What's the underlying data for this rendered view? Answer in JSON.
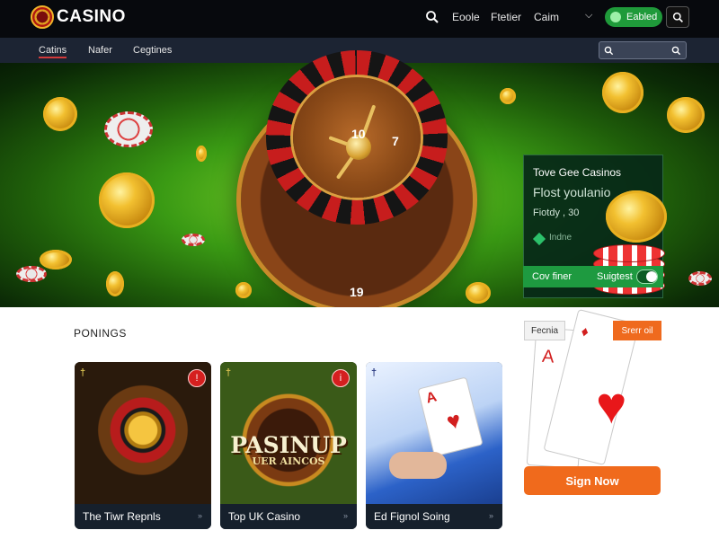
{
  "brand": {
    "name": "CASINO"
  },
  "topbar": {
    "links": [
      "Eoole",
      "Ftetier",
      "Caim"
    ],
    "enabled_label": "Eabled"
  },
  "nav": {
    "tabs": [
      "Catins",
      "Nafer",
      "Cegtines"
    ],
    "active_tab": "Catins",
    "search_placeholder": ""
  },
  "hero": {
    "wheel_numbers": [
      "10",
      "7",
      "19"
    ],
    "promo": {
      "title": "Tove Gee Casinos",
      "subtitle": "Flost youlanio",
      "price": "Fiotdy , 30",
      "flag_label": "Indne",
      "bar_left": "Cov finer",
      "bar_right": "Suigtest"
    }
  },
  "section": {
    "label": "PONINGS"
  },
  "cards": [
    {
      "title": "The Tiwr Repnls",
      "badge": "!"
    },
    {
      "title": "Top UK Casino",
      "badge": "i",
      "logo_text": "PASINUP",
      "logo_sub": "UER AINCOS"
    },
    {
      "title": "Ed Fignol Soing"
    }
  ],
  "side": {
    "tag_left": "Fecnia",
    "tag_right": "Srerr oil",
    "signup_label": "Sign Now"
  },
  "colors": {
    "accent_orange": "#f06a1c",
    "accent_green": "#1f9a3a",
    "badge_red": "#d51f1f",
    "topbar_bg": "#07090d",
    "nav_bg": "#1c2433"
  }
}
